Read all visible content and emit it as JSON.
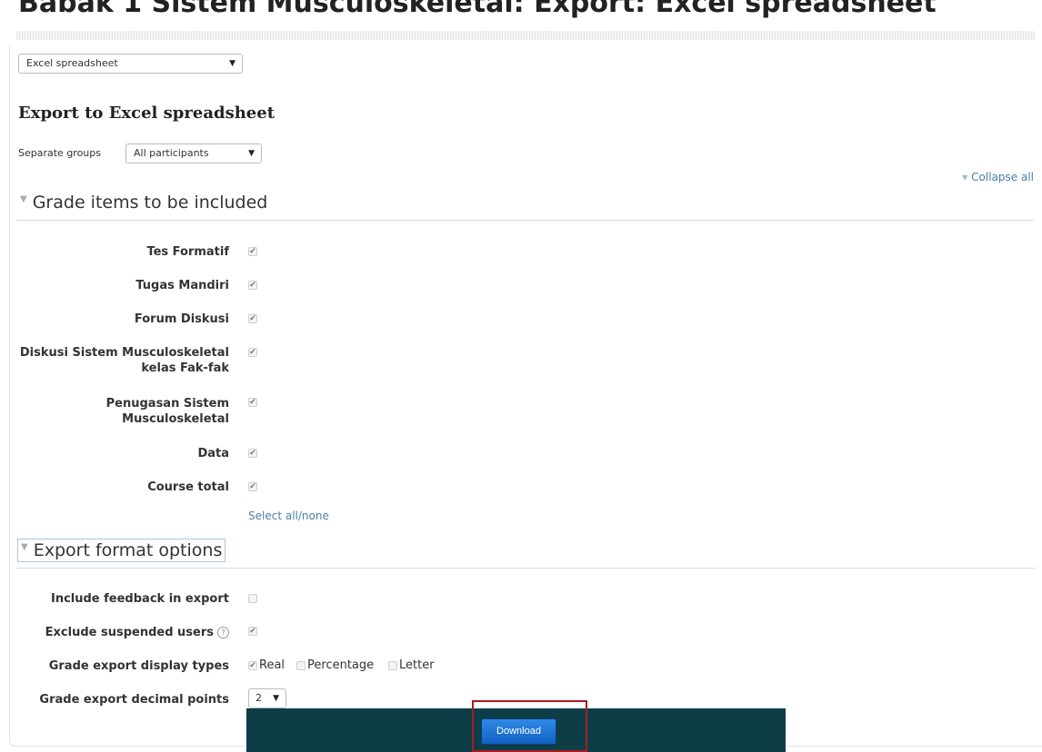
{
  "page": {
    "title": "Babak 1 Sistem Musculoskeletal: Export: Excel spreadsheet"
  },
  "export_type_select": {
    "value": "Excel spreadsheet"
  },
  "export_heading": "Export to Excel spreadsheet",
  "groups": {
    "label": "Separate groups",
    "value": "All participants"
  },
  "collapse_all": "Collapse all",
  "grade_items": {
    "legend": "Grade items to be included",
    "items": [
      {
        "label": "Tes Formatif",
        "checked": true
      },
      {
        "label": "Tugas Mandiri",
        "checked": true
      },
      {
        "label": "Forum Diskusi",
        "checked": true
      },
      {
        "label": "Diskusi Sistem Musculoskeletal kelas Fak-fak",
        "checked": true
      },
      {
        "label": "Penugasan Sistem Musculoskeletal",
        "checked": true
      },
      {
        "label": "Data",
        "checked": true
      },
      {
        "label": "Course total",
        "checked": true
      }
    ],
    "select_all": "Select all/none"
  },
  "format_options": {
    "legend": "Export format options",
    "include_feedback": {
      "label": "Include feedback in export",
      "checked": false
    },
    "exclude_suspended": {
      "label": "Exclude suspended users",
      "checked": true
    },
    "display_types": {
      "label": "Grade export display types",
      "options": [
        {
          "label": "Real",
          "checked": true
        },
        {
          "label": "Percentage",
          "checked": false
        },
        {
          "label": "Letter",
          "checked": false
        }
      ]
    },
    "decimal_points": {
      "label": "Grade export decimal points",
      "value": "2"
    }
  },
  "download_label": "Download",
  "colors": {
    "footer": "#0d3d47",
    "button": "#1f72d2",
    "highlight": "#a81c22",
    "link": "#4a7fa8"
  },
  "icons": {
    "checkbox": "checkmark",
    "help": "question-circle-icon",
    "collapse": "triangle-down-icon"
  }
}
